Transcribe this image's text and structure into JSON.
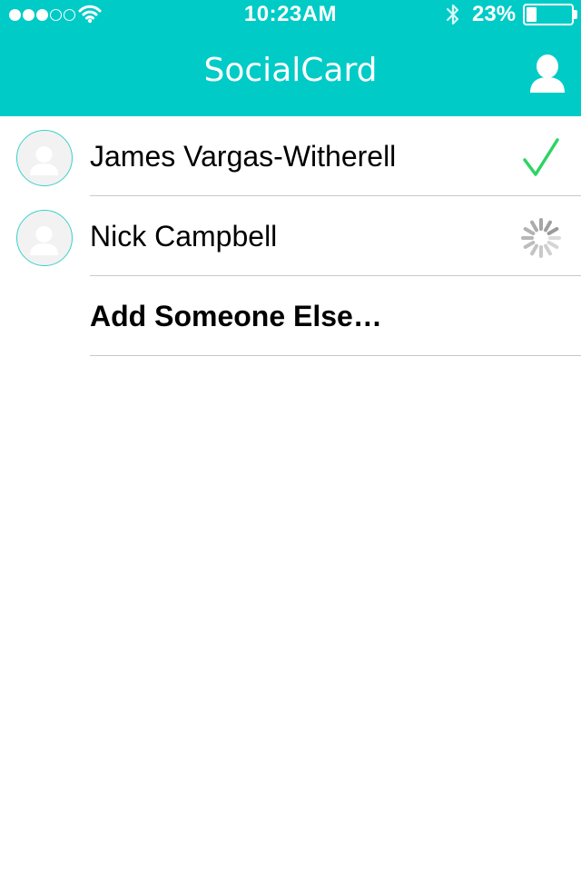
{
  "status_bar": {
    "time": "10:23AM",
    "battery_percent_label": "23%",
    "battery_level": 0.23,
    "signal": {
      "filled": 3,
      "total": 5
    },
    "icons": [
      "wifi-icon",
      "bluetooth-icon",
      "battery-icon"
    ]
  },
  "nav": {
    "title": "SocialCard",
    "right_icon": "person-icon"
  },
  "contacts": [
    {
      "name": "James Vargas-Witherell",
      "status": "sent",
      "status_icon": "checkmark-icon",
      "status_color": "#2ed463"
    },
    {
      "name": "Nick Campbell",
      "status": "sending",
      "status_icon": "spinner-icon",
      "status_color": "#9a9a9a"
    }
  ],
  "add_action": {
    "label": "Add Someone Else…"
  },
  "colors": {
    "accent": "#00cbc7",
    "avatar_ring": "#3ccfcc",
    "separator": "#c8c8cc",
    "success": "#2ed463"
  }
}
